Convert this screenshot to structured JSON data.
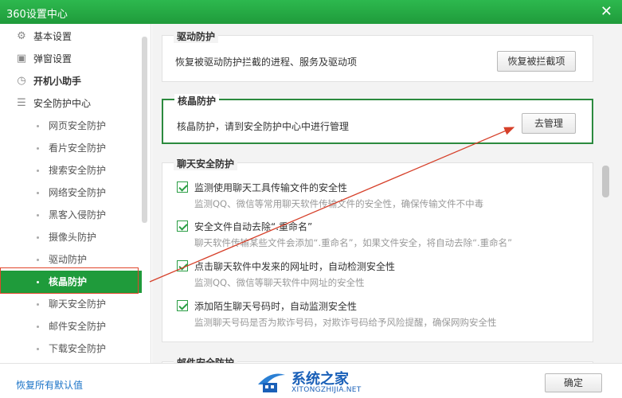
{
  "window": {
    "title": "360设置中心",
    "close_icon": "close-icon"
  },
  "sidebar": {
    "categories": [
      {
        "label": "基本设置",
        "icon": "gear-icon"
      },
      {
        "label": "弹窗设置",
        "icon": "window-icon"
      },
      {
        "label": "开机小助手",
        "icon": "clock-icon"
      },
      {
        "label": "安全防护中心",
        "icon": "list-icon"
      }
    ],
    "items": [
      "网页安全防护",
      "看片安全防护",
      "搜索安全防护",
      "网络安全防护",
      "黑客入侵防护",
      "摄像头防护",
      "驱动防护",
      "核晶防护",
      "聊天安全防护",
      "邮件安全防护",
      "下载安全防护"
    ],
    "active": "核晶防护"
  },
  "main": {
    "driver": {
      "title": "驱动防护",
      "desc": "恢复被驱动防护拦截的进程、服务及驱动项",
      "button": "恢复被拦截项"
    },
    "core": {
      "title": "核晶防护",
      "desc": "核晶防护，请到安全防护中心中进行管理",
      "button": "去管理"
    },
    "chat": {
      "title": "聊天安全防护",
      "options": [
        {
          "label": "监测使用聊天工具传输文件的安全性",
          "sub": "监测QQ、微信等常用聊天软件传输文件的安全性，确保传输文件不中毒",
          "checked": true
        },
        {
          "label": "安全文件自动去除“.重命名”",
          "sub": "聊天软件传输某些文件会添加“.重命名”，如果文件安全，将自动去除“.重命名”",
          "checked": true
        },
        {
          "label": "点击聊天软件中发来的网址时，自动检测安全性",
          "sub": "监测QQ、微信等聊天软件中网址的安全性",
          "checked": true
        },
        {
          "label": "添加陌生聊天号码时，自动监测安全性",
          "sub": "监测聊天号码是否为欺诈号码，对欺诈号码给予风险提醒，确保网购安全性",
          "checked": true
        }
      ]
    },
    "mail": {
      "title": "邮件安全防护"
    }
  },
  "footer": {
    "restore": "恢复所有默认值",
    "ok": "确定"
  },
  "watermark": {
    "cn": "系统之家",
    "en": "XITONGZHIJIA.NET"
  },
  "colors": {
    "accent": "#1f9b3b",
    "highlight_border": "#2b8a3e",
    "annotation": "#e0452b",
    "link": "#1a73c7"
  }
}
